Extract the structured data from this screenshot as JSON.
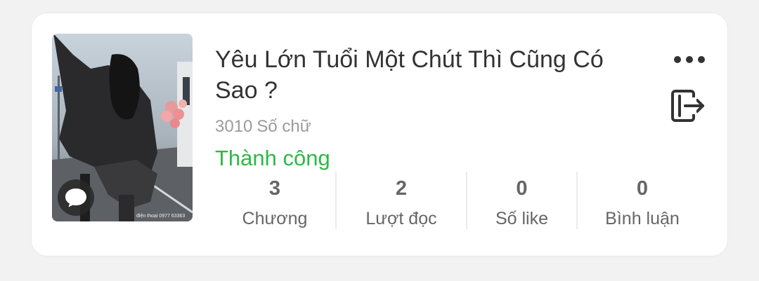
{
  "story": {
    "title": "Yêu Lớn Tuổi Một Chút Thì Cũng Có Sao ?",
    "word_count": "3010",
    "word_count_label": "Số chữ",
    "status": "Thành công",
    "status_color": "#2db946",
    "cover_caption": "điện thoại 0977 63363"
  },
  "actions": {
    "more_icon": "more-horizontal-icon",
    "exit_icon": "exit-icon",
    "comment_icon": "chat-bubble-icon"
  },
  "stats": [
    {
      "value": "3",
      "label": "Chương"
    },
    {
      "value": "2",
      "label": "Lượt đọc"
    },
    {
      "value": "0",
      "label": "Số like"
    },
    {
      "value": "0",
      "label": "Bình luận"
    }
  ]
}
